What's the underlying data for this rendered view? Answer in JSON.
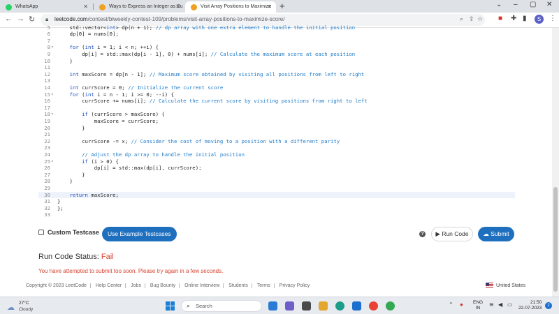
{
  "browser": {
    "tabs": [
      {
        "title": "WhatsApp",
        "favicon_color": "#25d366"
      },
      {
        "title": "Ways to Express an Integer as Su",
        "favicon_color": "#f0a020"
      },
      {
        "title": "Visit Array Positions to Maximize",
        "favicon_color": "#f0a020"
      }
    ],
    "new_tab": "+",
    "window_controls": {
      "minimize": "–",
      "restore": "▢",
      "close": "✕",
      "dropdown": "⌄"
    },
    "url_host": "leetcode.com",
    "url_path": "/contest/biweekly-contest-109/problems/visit-array-positions-to-maximize-score/",
    "profile_initial": "S"
  },
  "editor": {
    "lines": [
      {
        "n": "5",
        "fold": "",
        "code": "    std::vector<int> dp(n + 1); // dp array with one extra element to handle the initial position"
      },
      {
        "n": "6",
        "fold": "",
        "code": "    dp[0] = nums[0];"
      },
      {
        "n": "7",
        "fold": "",
        "code": ""
      },
      {
        "n": "8",
        "fold": "▾",
        "code": "    for (int i = 1; i < n; ++i) {"
      },
      {
        "n": "9",
        "fold": "",
        "code": "        dp[i] = std::max(dp[i - 1], 0) + nums[i]; // Calculate the maximum score at each position"
      },
      {
        "n": "10",
        "fold": "",
        "code": "    }"
      },
      {
        "n": "11",
        "fold": "",
        "code": ""
      },
      {
        "n": "12",
        "fold": "",
        "code": "    int maxScore = dp[n - 1]; // Maximum score obtained by visiting all positions from left to right"
      },
      {
        "n": "13",
        "fold": "",
        "code": ""
      },
      {
        "n": "14",
        "fold": "",
        "code": "    int currScore = 0; // Initialize the current score"
      },
      {
        "n": "15",
        "fold": "▾",
        "code": "    for (int i = n - 1; i >= 0; --i) {"
      },
      {
        "n": "16",
        "fold": "",
        "code": "        currScore += nums[i]; // Calculate the current score by visiting positions from right to left"
      },
      {
        "n": "17",
        "fold": "",
        "code": ""
      },
      {
        "n": "18",
        "fold": "▾",
        "code": "        if (currScore > maxScore) {"
      },
      {
        "n": "19",
        "fold": "",
        "code": "            maxScore = currScore;"
      },
      {
        "n": "20",
        "fold": "",
        "code": "        }"
      },
      {
        "n": "21",
        "fold": "",
        "code": ""
      },
      {
        "n": "22",
        "fold": "",
        "code": "        currScore -= x; // Consider the cost of moving to a position with a different parity"
      },
      {
        "n": "23",
        "fold": "",
        "code": ""
      },
      {
        "n": "24",
        "fold": "",
        "code": "        // Adjust the dp array to handle the initial position"
      },
      {
        "n": "25",
        "fold": "▾",
        "code": "        if (i > 0) {"
      },
      {
        "n": "26",
        "fold": "",
        "code": "            dp[i] = std::max(dp[i], currScore);"
      },
      {
        "n": "27",
        "fold": "",
        "code": "        }"
      },
      {
        "n": "28",
        "fold": "",
        "code": "    }"
      },
      {
        "n": "29",
        "fold": "",
        "code": ""
      },
      {
        "n": "30",
        "fold": "",
        "code": "    return maxScore;"
      },
      {
        "n": "31",
        "fold": "",
        "code": "}"
      },
      {
        "n": "32",
        "fold": "",
        "code": "};"
      },
      {
        "n": "33",
        "fold": "",
        "code": ""
      }
    ]
  },
  "controls": {
    "custom_testcase_label": "Custom Testcase",
    "example_testcases_label": "Use Example Testcases",
    "help_glyph": "?",
    "run_code_label": "Run Code",
    "submit_label": "Submit"
  },
  "status": {
    "label": "Run Code Status:",
    "value": "Fail",
    "message": "You have attempted to submit too soon. Please try again in a few seconds."
  },
  "footer": {
    "copyright": "Copyright © 2023 LeetCode",
    "links": [
      "Help Center",
      "Jobs",
      "Bug Bounty",
      "Online Interview",
      "Students",
      "Terms",
      "Privacy Policy"
    ],
    "region": "United States"
  },
  "taskbar": {
    "temperature": "27°C",
    "weather": "Cloudy",
    "search_placeholder": "Search",
    "language_top": "ENG",
    "language_bottom": "IN",
    "time": "21:50",
    "date": "22-07-2023",
    "notification_count": "2"
  },
  "colors": {
    "accent": "#1f6fbf",
    "fail": "#d9432f",
    "keyword": "#1a4fc4",
    "comment": "#1d7ac9"
  }
}
